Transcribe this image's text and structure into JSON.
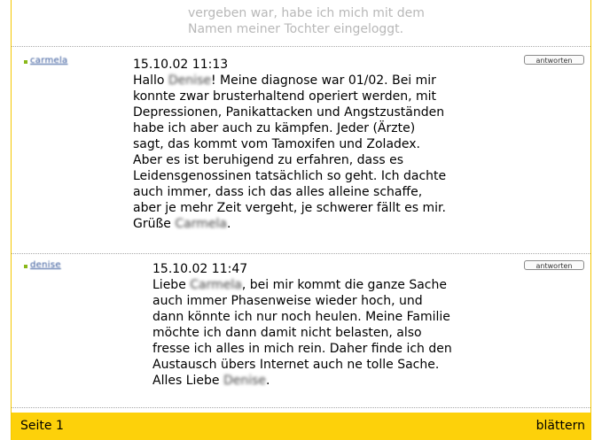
{
  "intro_fragment": {
    "line1": "vergeben war, habe ich mich mit dem",
    "line2": "Namen meiner Tochter eingeloggt."
  },
  "posts": [
    {
      "author": "carmela",
      "timestamp": "15.10.02 11:13",
      "reply_label": "antworten",
      "lines": [
        {
          "pre": "Hallo ",
          "blur": "Denise",
          "post": "! Meine diagnose war 01/02. Bei mir"
        },
        {
          "pre": "konnte zwar brusterhaltend operiert werden, mit"
        },
        {
          "pre": "Depressionen, Panikattacken und Angstzuständen"
        },
        {
          "pre": "habe ich aber auch zu kämpfen. Jeder (Ärzte)"
        },
        {
          "pre": "sagt, das kommt vom Tamoxifen und Zoladex."
        },
        {
          "pre": "Aber es ist beruhigend zu erfahren, dass es"
        },
        {
          "pre": "Leidensgenossinen tatsächlich so geht. Ich dachte"
        },
        {
          "pre": "auch immer, dass ich das alles alleine schaffe,"
        },
        {
          "pre": "aber je mehr Zeit vergeht, je schwerer fällt es mir."
        },
        {
          "pre": "Grüße ",
          "blur": "Carmela",
          "post": "."
        }
      ]
    },
    {
      "author": "denise",
      "timestamp": "15.10.02 11:47",
      "reply_label": "antworten",
      "lines": [
        {
          "pre": "Liebe ",
          "blur": "Carmela",
          "post": ", bei mir kommt die ganze Sache"
        },
        {
          "pre": "auch immer Phasenweise wieder hoch, und"
        },
        {
          "pre": "dann könnte ich nur noch heulen. Meine Familie"
        },
        {
          "pre": "möchte ich dann damit nicht belasten, also"
        },
        {
          "pre": "fresse ich alles in mich rein. Daher finde ich den"
        },
        {
          "pre": "Austausch übers Internet auch ne tolle Sache."
        },
        {
          "pre": "Alles Liebe ",
          "blur": "Denise",
          "post": "."
        }
      ]
    }
  ],
  "footer": {
    "page_label": "Seite 1",
    "next_label": "blättern"
  },
  "colors": {
    "accent_yellow": "#fdd10a",
    "link_blue": "#335599",
    "bullet_green": "#8ab81a"
  }
}
